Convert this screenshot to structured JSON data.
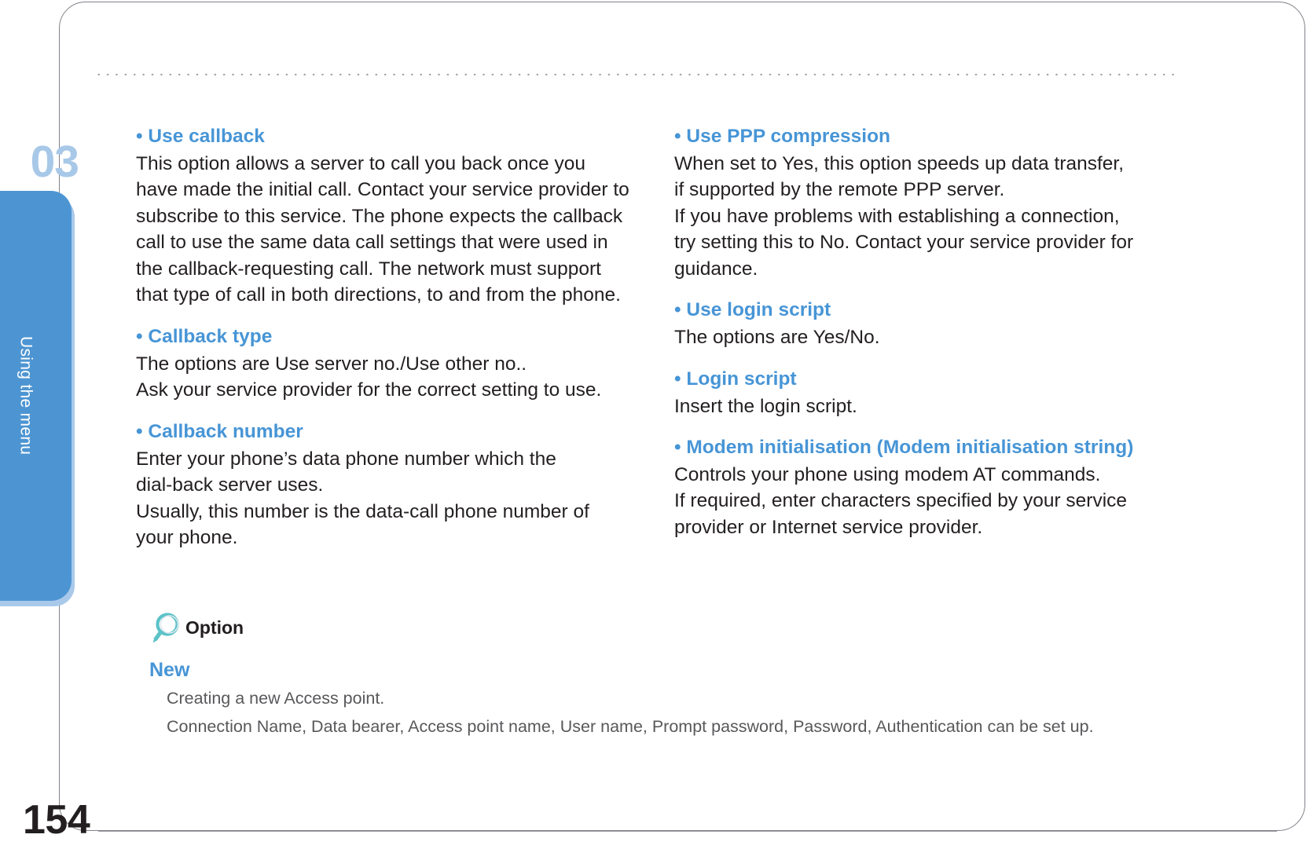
{
  "page": {
    "number": "154",
    "chapter_number": "03",
    "side_tab_label": "Using the menu"
  },
  "columns": {
    "left": [
      {
        "title": "• Use callback",
        "lines": [
          "This option allows a server to call you back once you",
          "have made the initial call. Contact your service provider to",
          "subscribe to this service. The phone expects the callback",
          "call to use the same data call settings that were used in",
          "the callback-requesting call. The network must support",
          "that type of call in both directions, to and from the phone."
        ]
      },
      {
        "title": "• Callback type",
        "lines": [
          "The options are Use server no./Use other no..",
          "Ask your service provider for the correct setting to use."
        ]
      },
      {
        "title": "• Callback number",
        "lines": [
          "Enter your phone’s data phone number which the",
          "dial-back server uses.",
          "Usually, this number is the data-call phone number of",
          "your phone."
        ]
      }
    ],
    "right": [
      {
        "title": "• Use PPP compression",
        "lines": [
          "When set to Yes, this option speeds up data transfer,",
          "if supported by the remote PPP server.",
          "If you have problems with establishing a connection,",
          "try setting this to No. Contact your service provider for",
          "guidance."
        ]
      },
      {
        "title": "• Use login script",
        "lines": [
          "The options are Yes/No."
        ]
      },
      {
        "title": "• Login script",
        "lines": [
          "Insert the login script."
        ]
      },
      {
        "title": "• Modem initialisation (Modem initialisation string)",
        "lines": [
          "Controls your phone using modem AT commands.",
          "If required, enter characters specified by your service",
          "provider or Internet service provider."
        ]
      }
    ]
  },
  "option_note": {
    "icon": "magnifier-icon",
    "label": "Option",
    "new_title": "New",
    "lines": [
      "Creating a new Access point.",
      "Connection Name, Data bearer, Access point name, User name, Prompt password, Password, Authentication  can be set up."
    ]
  },
  "colors": {
    "accent_blue": "#4795d6",
    "tab_blue": "#4d95d2",
    "tab_shadow_blue": "#a9c9ea",
    "chapter_blue": "#a8c8e8",
    "icon_teal": "#5cc3c8",
    "body_text": "#231f20",
    "note_text": "#58585b",
    "frame_gray": "#808289"
  }
}
